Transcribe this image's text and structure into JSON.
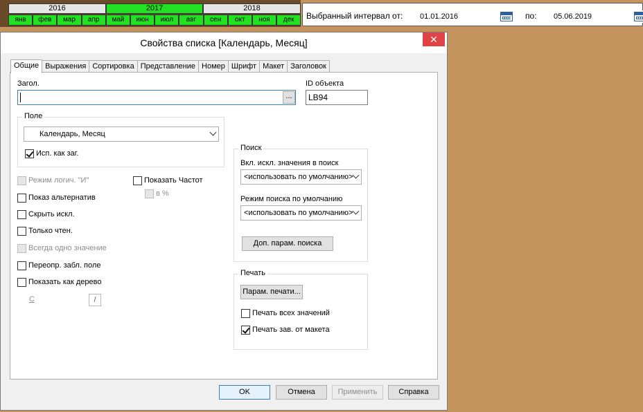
{
  "calendar": {
    "years": [
      "2016",
      "2017",
      "2018"
    ],
    "selected_year": "2017",
    "months": [
      "янв",
      "фев",
      "мар",
      "апр",
      "май",
      "июн",
      "июл",
      "авг",
      "сен",
      "окт",
      "ноя",
      "дек"
    ]
  },
  "interval": {
    "from_label": "Выбранный интервал от:",
    "from_value": "01.01.2016",
    "to_label": "по:",
    "to_value": "05.06.2019"
  },
  "dialog": {
    "title": "Свойства списка [Календарь, Месяц]",
    "close_glyph": "✕",
    "tabs": [
      "Общие",
      "Выражения",
      "Сортировка",
      "Представление",
      "Номер",
      "Шрифт",
      "Макет",
      "Заголовок"
    ],
    "active_tab": "Общие",
    "title_label": "Загол.",
    "title_value": "",
    "dots_label": "...",
    "object_id_label": "ID объекта",
    "object_id_value": "LB94",
    "field_group": {
      "label": "Поле",
      "selected": "Календарь, Месяц",
      "use_as_title_label": "Исп. как заг.",
      "use_as_title_checked": true
    },
    "options": {
      "logic_and": "Режим логич. \"И\"",
      "show_alternatives": "Показ альтернатив",
      "hide_excluded": "Скрыть искл.",
      "read_only": "Только чтен.",
      "always_one": "Всегда одно значение",
      "override_locked": "Переопр. забл. поле",
      "show_as_tree": "Показать как дерево",
      "show_frequency": "Показать Частот",
      "in_percent": "в %",
      "tree_from_label": "С",
      "tree_sep": "/"
    },
    "search_group": {
      "label": "Поиск",
      "include_excluded_label": "Вкл. искл. значения в поиск",
      "include_excluded_value": "<использовать по умолчанию>",
      "default_mode_label": "Режим поиска по умолчанию",
      "default_mode_value": "<использовать по умолчанию>",
      "extra_params_button": "Доп. парам. поиска"
    },
    "print_group": {
      "label": "Печать",
      "params_button": "Парам. печати...",
      "print_all_label": "Печать всех значений",
      "print_all_checked": false,
      "print_by_layout_label": "Печать зав. от макета",
      "print_by_layout_checked": true
    },
    "buttons": {
      "ok": "OK",
      "cancel": "Отмена",
      "apply": "Применить",
      "help": "Справка"
    }
  }
}
